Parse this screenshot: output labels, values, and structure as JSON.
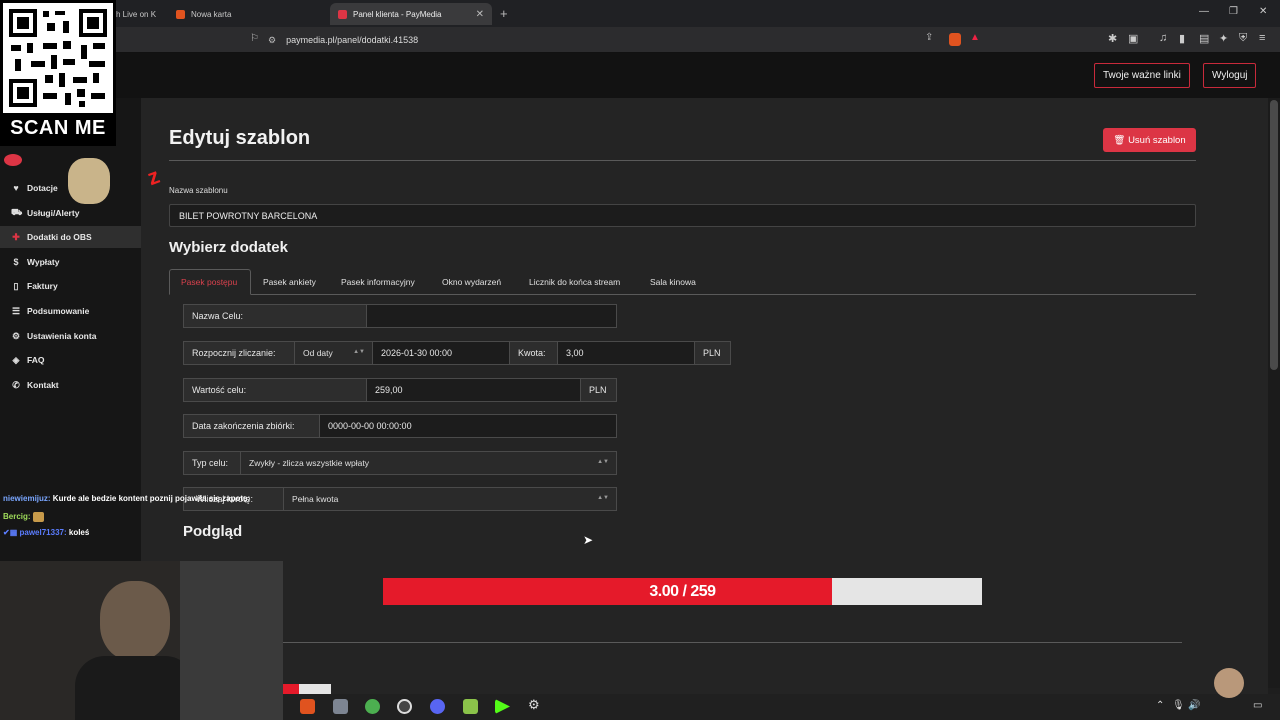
{
  "browser": {
    "tabs": [
      {
        "title": "h Live on K"
      },
      {
        "title": "Nowa karta"
      },
      {
        "title": "Panel klienta - PayMedia"
      }
    ],
    "url": "paymedia.pl/panel/dodatki.41538"
  },
  "topnav": {
    "links_button": "Twoje ważne linki",
    "logout_button": "Wyloguj"
  },
  "sidebar": {
    "items": [
      {
        "label": "Dotacje",
        "icon": "heart"
      },
      {
        "label": "Usługi/Alerty",
        "icon": "cart"
      },
      {
        "label": "Dodatki do OBS",
        "icon": "puzzle",
        "active": true
      },
      {
        "label": "Wypłaty",
        "icon": "dollar"
      },
      {
        "label": "Faktury",
        "icon": "file"
      },
      {
        "label": "Podsumowanie",
        "icon": "list"
      },
      {
        "label": "Ustawienia konta",
        "icon": "gear"
      },
      {
        "label": "FAQ",
        "icon": "layers"
      },
      {
        "label": "Kontakt",
        "icon": "phone"
      }
    ]
  },
  "page": {
    "title": "Edytuj szablon",
    "delete_button": "Usuń szablon",
    "template_name_label": "Nazwa szablonu",
    "template_name_value": "BILET POWROTNY BARCELONA",
    "choose_addon_heading": "Wybierz dodatek",
    "addon_tabs": [
      "Pasek postępu",
      "Pasek ankiety",
      "Pasek informacyjny",
      "Okno wydarzeń",
      "Licznik do końca stream",
      "Sala kinowa"
    ],
    "form": {
      "goal_name_label": "Nazwa Celu:",
      "goal_name_value": "",
      "start_counting_label": "Rozpocznij zliczanie:",
      "start_mode": "Od daty",
      "start_date": "2026-01-30 00:00",
      "amount_label": "Kwota:",
      "amount_value": "3,00",
      "currency": "PLN",
      "goal_value_label": "Wartość celu:",
      "goal_value": "259,00",
      "end_date_label": "Data zakończenia zbiórki:",
      "end_date_value": "0000-00-00 00:00:00",
      "goal_type_label": "Typ celu:",
      "goal_type_value": "Zwykły - zlicza wszystkie wpłaty",
      "payment_label": "Wliczaj kwotę:",
      "payment_value": "Pełna kwota"
    },
    "preview_heading": "Podgląd",
    "progress": {
      "text": "3.00 / 259",
      "fraction": 0.75
    }
  },
  "overlay": {
    "qr_label": "SCAN ME",
    "chat": [
      {
        "user": "niewiemijuz:",
        "message": "Kurde ale bedzie kontent poznij pojawiła się zapotę:",
        "color": "#7aa6ff"
      },
      {
        "user": "Bercig:",
        "message": "",
        "color": "#9fdc5a"
      },
      {
        "user": "pawel71337:",
        "message": "koleś",
        "color": "#5b7dff"
      }
    ]
  },
  "colors": {
    "accent": "#dc3545",
    "progress_fill": "#e51a2a",
    "progress_bg": "#e5e5e5"
  }
}
